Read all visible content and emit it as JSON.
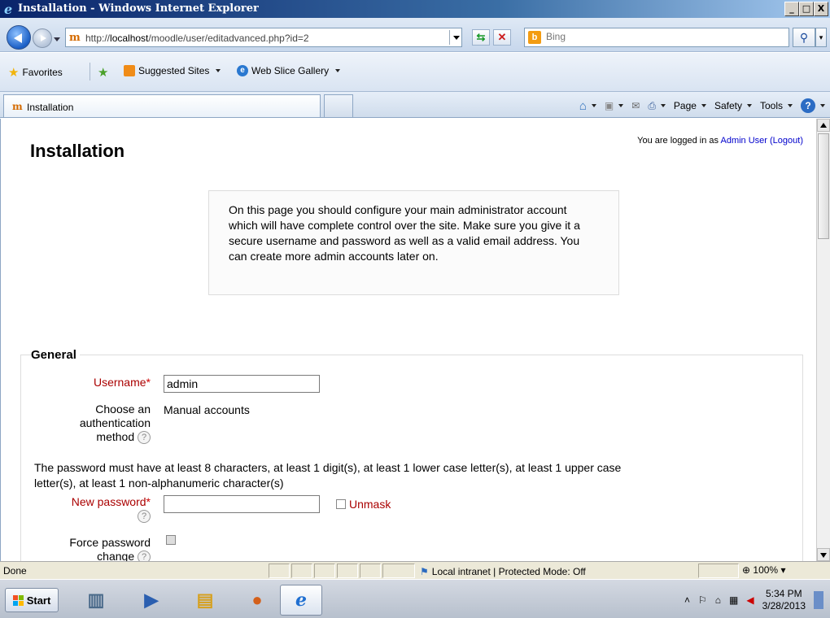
{
  "window": {
    "title": "Installation - Windows Internet Explorer",
    "controls": [
      "_",
      "□",
      "X"
    ]
  },
  "addressbar": {
    "url_prefix": "http://",
    "url_host": "localhost",
    "url_path": "/moodle/user/editadvanced.php?id=2"
  },
  "search": {
    "placeholder": "Bing"
  },
  "favorites_bar": {
    "favorites_label": "Favorites",
    "items": [
      "Suggested Sites",
      "Web Slice Gallery"
    ]
  },
  "tab": {
    "label": "Installation"
  },
  "commandbar": {
    "page": "Page",
    "safety": "Safety",
    "tools": "Tools",
    "help": "?"
  },
  "page": {
    "title": "Installation",
    "login": {
      "prefix": "You are logged in as",
      "user": "Admin User",
      "logout": "(Logout)"
    },
    "info": "On this page you should configure your main administrator account which will have complete control over the site. Make sure you give it a secure username and password as well as a valid email address. You can create more admin accounts later on.",
    "section": "General",
    "username_label": "Username",
    "username_value": "admin",
    "auth_label": "Choose an authentication method",
    "auth_value": "Manual accounts",
    "password_note": "The password must have at least 8 characters, at least 1 digit(s), at least 1 lower case letter(s), at least 1 upper case letter(s), at least 1 non-alphanumeric character(s)",
    "new_password_label": "New password",
    "unmask_label": "Unmask",
    "force_password_label": "Force password change",
    "required_mark": "*"
  },
  "statusbar": {
    "status": "Done",
    "zone": "Local intranet | Protected Mode: Off",
    "zoom": "100%"
  },
  "taskbar": {
    "start": "Start",
    "time": "5:34 PM",
    "date": "3/28/2013"
  },
  "colors": {
    "required": "#aa0000",
    "link": "#0000cc"
  }
}
